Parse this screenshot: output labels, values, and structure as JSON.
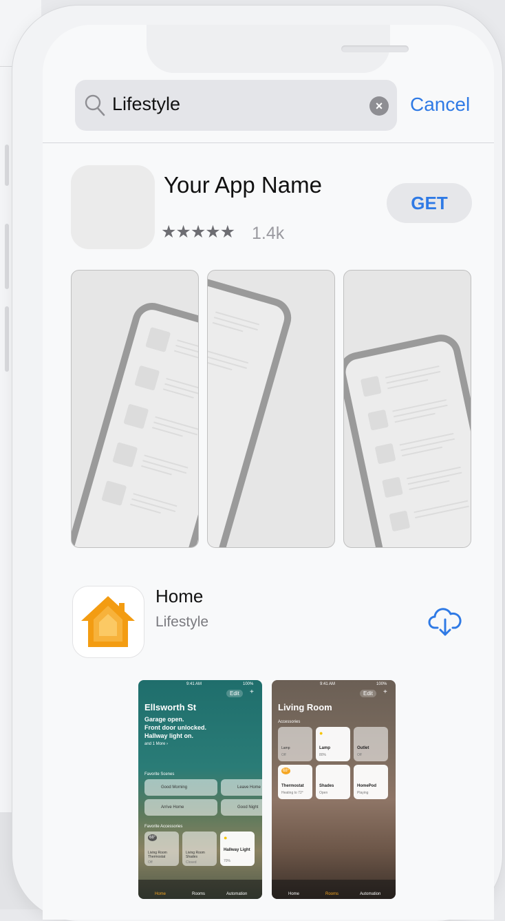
{
  "search": {
    "query": "Lifestyle",
    "clear_label": "×",
    "cancel_label": "Cancel"
  },
  "featured_app": {
    "name": "Your App Name",
    "stars": "★★★★★",
    "rating_count": "1.4k",
    "get_label": "GET"
  },
  "home_app": {
    "name": "Home",
    "category": "Lifestyle"
  },
  "screenshot_home": {
    "time": "9:41 AM",
    "battery": "100%",
    "edit": "Edit",
    "plus": "+",
    "title": "Ellsworth St",
    "lines": [
      "Garage open.",
      "Front door unlocked.",
      "Hallway light on."
    ],
    "more": "and 1 More ›",
    "scenes_header": "Favorite Scenes",
    "scenes": [
      "Good Morning",
      "Leave Home",
      "Arrive Home",
      "Good Night"
    ],
    "accessories_header": "Favorite Accessories",
    "accessories": [
      {
        "name": "Living Room Thermostat",
        "state": "Off",
        "badge": "68°"
      },
      {
        "name": "Living Room Shades",
        "state": "Closed"
      },
      {
        "name": "Hallway Light",
        "state": "70%"
      }
    ],
    "tabs": [
      "Home",
      "Rooms",
      "Automation"
    ]
  },
  "screenshot_room": {
    "time": "9:41 AM",
    "battery": "100%",
    "edit": "Edit",
    "plus": "+",
    "title": "Living Room",
    "section": "Accessories",
    "accessories": [
      {
        "name": "Lamp",
        "state": "Off"
      },
      {
        "name": "Lamp",
        "state": "80%"
      },
      {
        "name": "Outlet",
        "state": "Off"
      },
      {
        "name": "Thermostat",
        "state": "Heating to 72°",
        "badge": "68°"
      },
      {
        "name": "Shades",
        "state": "Open"
      },
      {
        "name": "HomePod",
        "state": "Playing"
      }
    ],
    "tabs": [
      "Home",
      "Rooms",
      "Automation"
    ]
  },
  "colors": {
    "accent": "#2f7ae5",
    "home_orange": "#f5a623"
  }
}
